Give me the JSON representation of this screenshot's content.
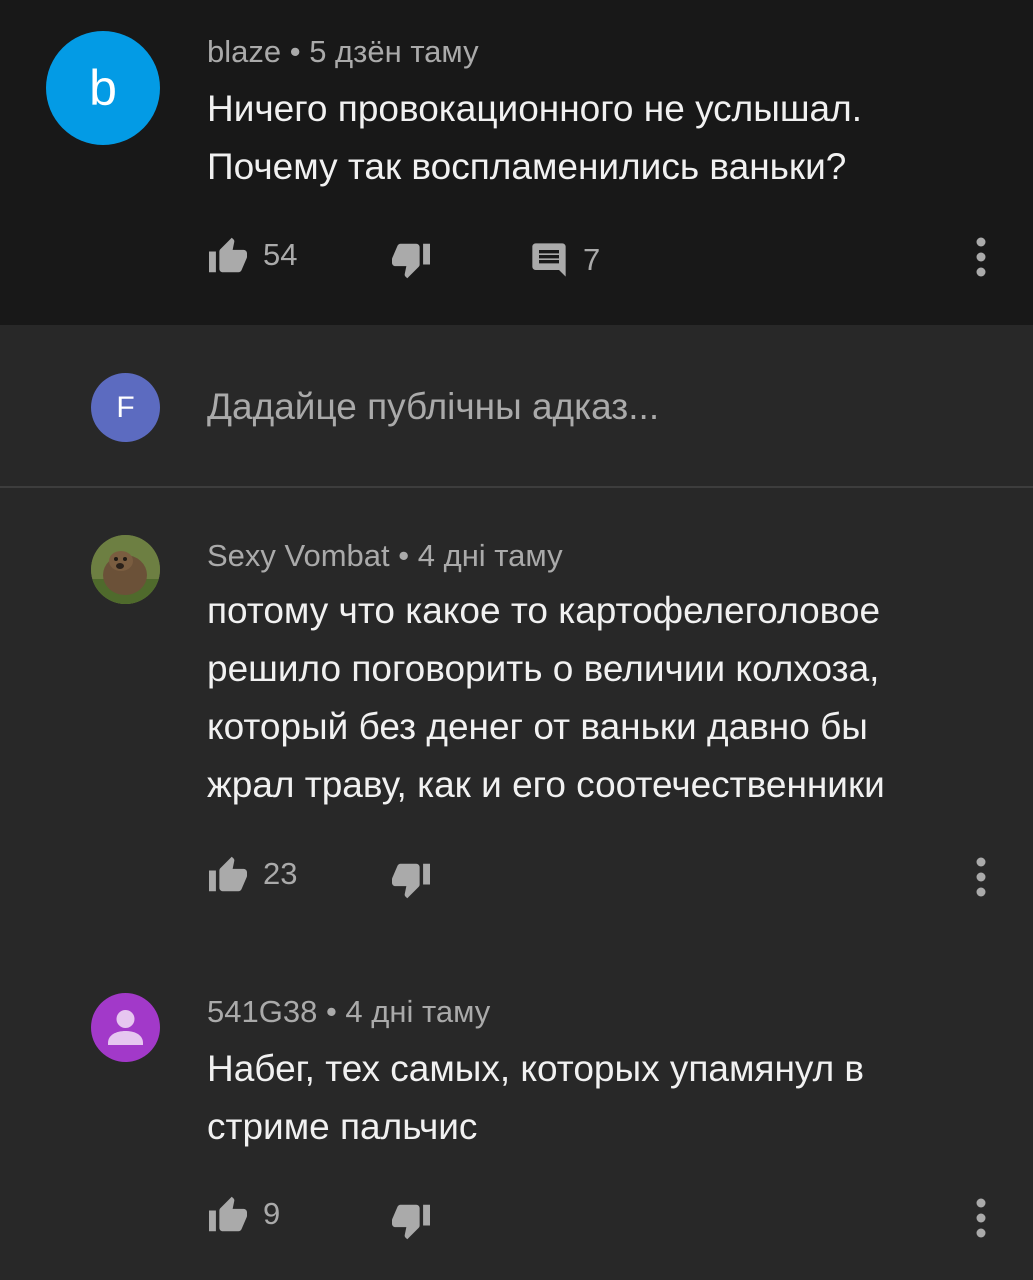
{
  "comments": [
    {
      "avatar_letter": "b",
      "avatar_color": "#039be5",
      "author": "blaze",
      "time": "5 дзён таму",
      "lines": [
        "Ничего провокационного не услышал.",
        "Почему так воспламенились ваньки?"
      ],
      "likes": "54",
      "replies": "7"
    },
    {
      "avatar_type": "photo",
      "author": "Sexy Vombat",
      "time": "4 дні таму",
      "lines": [
        "потому  что какое то картофелеголовое",
        "решило поговорить о величии колхоза,",
        "который без денег от ваньки давно бы",
        "жрал траву, как и его соотечественники"
      ],
      "likes": "23"
    },
    {
      "avatar_type": "default-person",
      "avatar_color": "#a239c9",
      "author": "541G38",
      "time": "4 дні таму",
      "lines": [
        "Набег, тех самых, которых упамянул в",
        "стриме пальчис"
      ],
      "likes": "9"
    }
  ],
  "reply_box": {
    "avatar_letter": "F",
    "avatar_color": "#5c6bc0",
    "placeholder": "Дадайце публічны адказ..."
  },
  "separator": " • ",
  "icons": {
    "like": "thumb-up-icon",
    "dislike": "thumb-down-icon",
    "reply": "comment-icon",
    "more": "more-vert-icon"
  }
}
